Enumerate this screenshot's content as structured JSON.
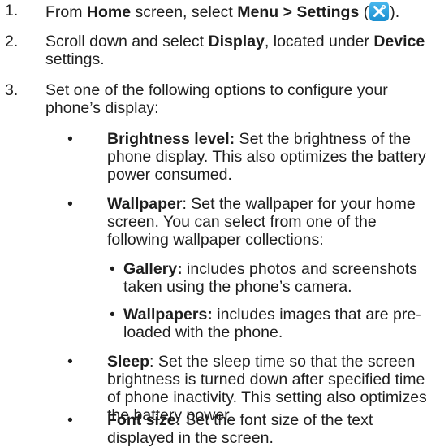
{
  "steps": [
    {
      "num": "1.",
      "pre": "From ",
      "b1": "Home",
      "mid1": " screen, select ",
      "b2": "Menu > Settings",
      "open": " (",
      "icon": "tools-icon",
      "close": ")."
    },
    {
      "num": "2.",
      "pre": "Scroll down and select ",
      "b1": "Display",
      "mid1": ", located under ",
      "b2": "Device",
      "post": " settings."
    },
    {
      "num": "3.",
      "text": "Set one of the following options to configure your phone’s display:"
    }
  ],
  "options": [
    {
      "term": "Brightness level:",
      "desc": " Set the brightness of the phone display. This also optimizes the battery power consumed."
    },
    {
      "term": "Wallpaper",
      "desc": ": Set the wallpaper for your home screen. You can select from one of the following wallpaper collections:"
    },
    {
      "term": "Sleep",
      "desc": ": Set the sleep time so that the screen brightness is turned down after specified time of phone inactivity. This setting also optimizes the battery power."
    },
    {
      "term": "Font size:",
      "desc": " Set the font size of the text displayed in the screen."
    }
  ],
  "wallpaper_sources": [
    {
      "term": "Gallery:",
      "desc": " includes photos and screenshots taken using the phone’s camera."
    },
    {
      "term": "Wallpapers:",
      "desc": " includes images that are pre-loaded with the phone."
    }
  ],
  "bullet_char": "•"
}
